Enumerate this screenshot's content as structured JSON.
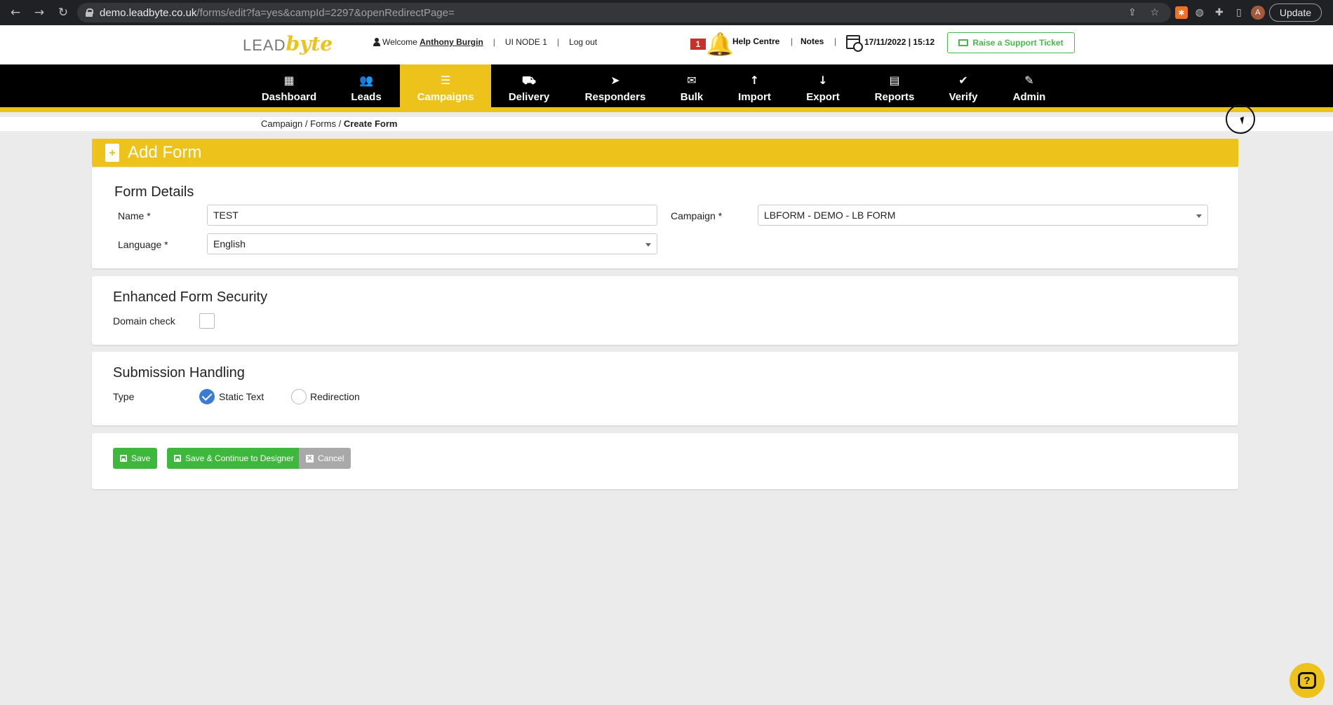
{
  "browser": {
    "url_host": "demo.leadbyte.co.uk",
    "url_path": "/forms/edit?fa=yes&campId=2297&openRedirectPage=",
    "update_label": "Update",
    "avatar_letter": "A"
  },
  "topbar": {
    "logo_lead": "LEAD",
    "logo_byte": "byte",
    "welcome_prefix": "Welcome",
    "user_name": "Anthony Burgin",
    "node": "UI NODE 1",
    "logout": "Log out",
    "notification_count": "1",
    "help_centre": "Help Centre",
    "notes": "Notes",
    "datetime": "17/11/2022 | 15:12",
    "support_ticket": "Raise a Support Ticket"
  },
  "nav": {
    "items": [
      {
        "label": "Dashboard",
        "icon": "grid-icon",
        "glyph": "▦"
      },
      {
        "label": "Leads",
        "icon": "users-icon",
        "glyph": "👥"
      },
      {
        "label": "Campaigns",
        "icon": "database-icon",
        "glyph": "☰"
      },
      {
        "label": "Delivery",
        "icon": "truck-icon",
        "glyph": "⛟"
      },
      {
        "label": "Responders",
        "icon": "paper-plane-icon",
        "glyph": "➤"
      },
      {
        "label": "Bulk",
        "icon": "mobile-envelope-icon",
        "glyph": "✉"
      },
      {
        "label": "Import",
        "icon": "arrow-up-icon",
        "glyph": "↑"
      },
      {
        "label": "Export",
        "icon": "arrow-down-icon",
        "glyph": "↓"
      },
      {
        "label": "Reports",
        "icon": "file-icon",
        "glyph": "▤"
      },
      {
        "label": "Verify",
        "icon": "check-circle-icon",
        "glyph": "✔"
      },
      {
        "label": "Admin",
        "icon": "edit-icon",
        "glyph": "✎"
      }
    ],
    "active": "Campaigns",
    "accent_color": "#edc21a"
  },
  "breadcrumb": {
    "campaign": "Campaign",
    "forms": "Forms",
    "current": "Create Form",
    "separator": "/"
  },
  "page": {
    "title": "Add Form"
  },
  "form_details": {
    "heading": "Form Details",
    "name_label": "Name *",
    "name_value": "TEST",
    "campaign_label": "Campaign *",
    "campaign_value": "LBFORM - DEMO - LB FORM",
    "language_label": "Language *",
    "language_value": "English"
  },
  "security": {
    "heading": "Enhanced Form Security",
    "domain_check_label": "Domain check",
    "domain_check_checked": false
  },
  "submission": {
    "heading": "Submission Handling",
    "type_label": "Type",
    "options": [
      "Static Text",
      "Redirection"
    ],
    "selected": "Static Text"
  },
  "actions": {
    "save": "Save",
    "save_continue": "Save & Continue to Designer",
    "cancel": "Cancel"
  }
}
